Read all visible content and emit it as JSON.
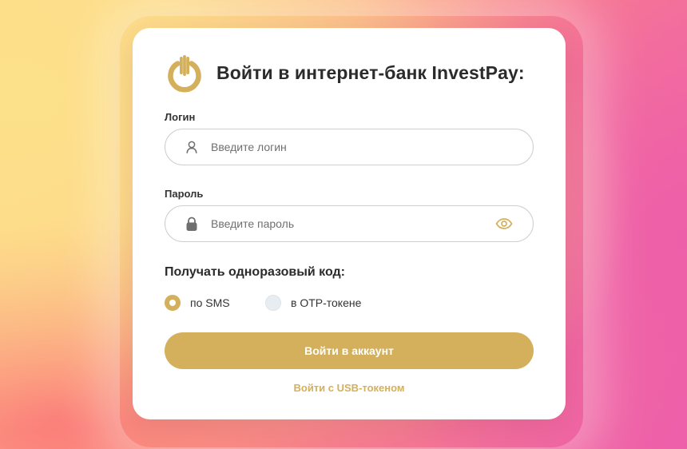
{
  "login": {
    "title": "Войти в интернет-банк InvestPay:",
    "logo_icon": "investpay-logo",
    "username": {
      "label": "Логин",
      "placeholder": "Введите логин",
      "value": "",
      "icon": "user-icon"
    },
    "password": {
      "label": "Пароль",
      "placeholder": "Введите пароль",
      "value": "",
      "icon": "lock-icon",
      "toggle_icon": "eye-icon"
    },
    "otp": {
      "title": "Получать одноразовый код:",
      "options": [
        {
          "label": "по SMS",
          "selected": true
        },
        {
          "label": "в OTP-токене",
          "selected": false
        }
      ]
    },
    "submit_label": "Войти в аккаунт",
    "usb_link": "Войти с USB-токеном"
  },
  "colors": {
    "accent": "#d4b05c",
    "text": "#2b2b2b",
    "placeholder": "#6f6f6f",
    "border": "#cfcfcf"
  }
}
